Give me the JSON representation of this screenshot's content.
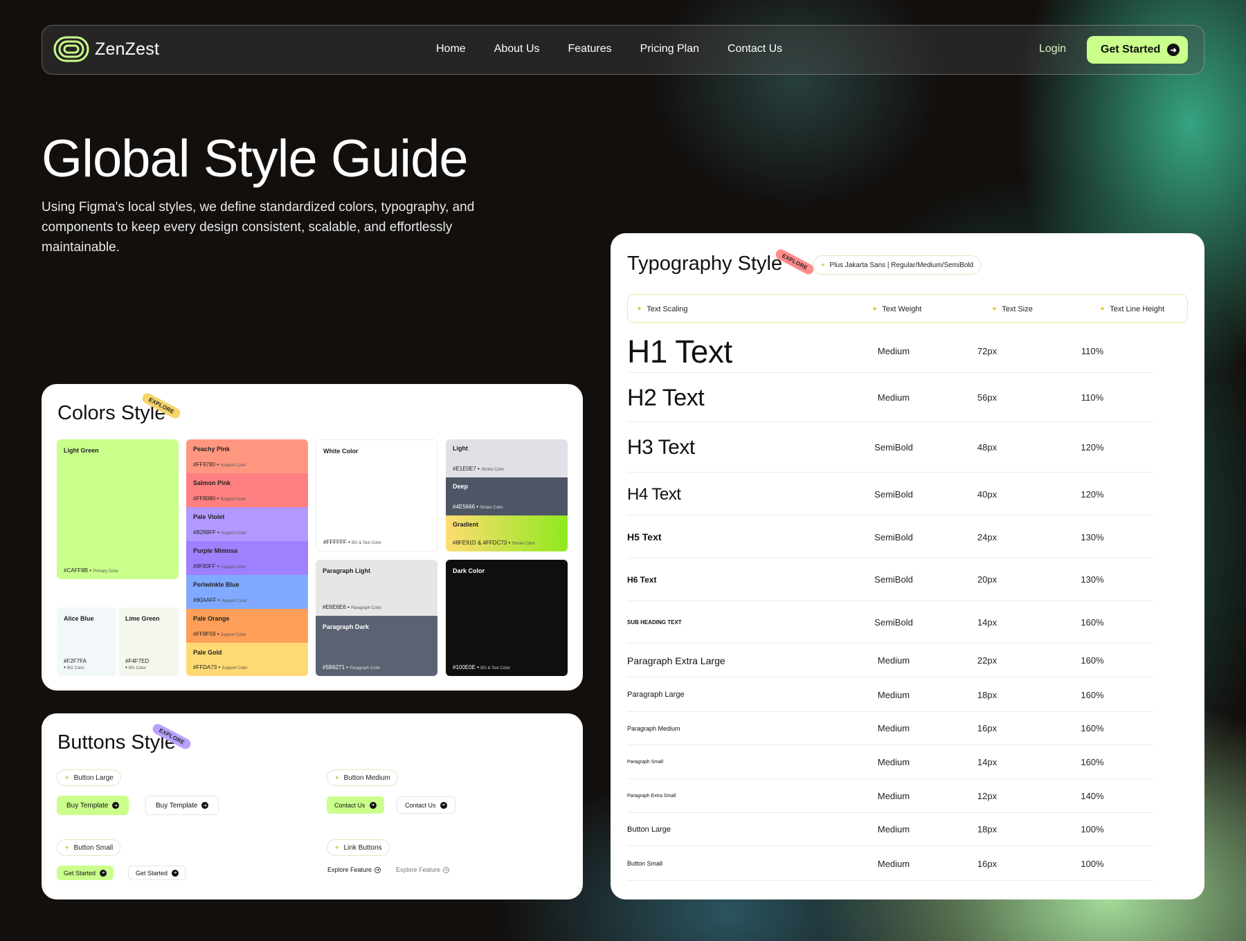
{
  "nav": {
    "brand": "ZenZest",
    "links": [
      "Home",
      "About Us",
      "Features",
      "Pricing Plan",
      "Contact Us"
    ],
    "login": "Login",
    "cta": "Get Started"
  },
  "hero": {
    "title": "Global Style Guide",
    "subtitle": "Using Figma's local styles, we define standardized colors, typography, and components to keep every design consistent, scalable, and effortlessly maintainable."
  },
  "colors": {
    "title": "Colors Style",
    "badge": "EXPLORE",
    "badge_color": "#F5D46A",
    "primary": {
      "name": "Light Green",
      "hex": "#CAFF8B",
      "role": "Primary Color",
      "color": "#CAFF8B"
    },
    "alice": {
      "name": "Alice Blue",
      "hex": "#F2F7FA",
      "role": "BG Color",
      "color": "#F2F7FA"
    },
    "lime": {
      "name": "Lime Green",
      "hex": "#F4F7ED",
      "role": "BG Color",
      "color": "#F4F7ED"
    },
    "support": [
      {
        "name": "Peachy Pink",
        "hex": "#FF9780",
        "role": "Support Color",
        "color": "#FF9780"
      },
      {
        "name": "Salmon Pink",
        "hex": "#FF8080",
        "role": "Support Color",
        "color": "#FF8080"
      },
      {
        "name": "Pale Violet",
        "hex": "#B299FF",
        "role": "Support Color",
        "color": "#B299FF"
      },
      {
        "name": "Purple Mimosa",
        "hex": "#9F80FF",
        "role": "Support Color",
        "color": "#9F80FF"
      },
      {
        "name": "Periwinkle Blue",
        "hex": "#80AAFF",
        "role": "Support Color",
        "color": "#80AAFF"
      },
      {
        "name": "Pale Orange",
        "hex": "#FF9F59",
        "role": "Support Color",
        "color": "#FF9F59"
      },
      {
        "name": "Pale Gold",
        "hex": "#FFDA73",
        "role": "Support Color",
        "color": "#FFDA73"
      }
    ],
    "white": {
      "name": "White Color",
      "hex": "#FFFFFF",
      "role": "BG & Text Color",
      "color": "#FFFFFF"
    },
    "para_light": {
      "name": "Paragraph Light",
      "hex": "#E6E6E6",
      "role": "Paragraph Color",
      "color": "#E6E6E6"
    },
    "para_dark": {
      "name": "Paragraph Dark",
      "hex": "#5B6271",
      "role": "Paragraph Color",
      "color": "#5B6271"
    },
    "light": {
      "name": "Light",
      "hex": "#E1E0E7",
      "role": "Stroke Color",
      "color": "#E1E0E7"
    },
    "deep": {
      "name": "Deep",
      "hex": "#4E5666",
      "role": "Stroke Color",
      "color": "#4E5666"
    },
    "gradient": {
      "name": "Gradient",
      "hex": "#8FE91D & #FFDC73",
      "role": "Stroke Color",
      "color_a": "#FFDC73",
      "color_b": "#8FE91D"
    },
    "dark": {
      "name": "Dark Color",
      "hex": "#100E0E",
      "role": "BG & Text Color",
      "color": "#100E0E"
    }
  },
  "buttons": {
    "title": "Buttons Style",
    "badge": "EXPLORE",
    "badge_color": "#B9A2FF",
    "large_label": "Button Large",
    "large_primary": "Buy Template",
    "large_secondary": "Buy Template",
    "medium_label": "Button Medium",
    "medium_primary": "Contact Us",
    "medium_secondary": "Contact Us",
    "small_label": "Button Small",
    "small_primary": "Get Started",
    "small_secondary": "Get Started",
    "link_label": "Link Buttons",
    "link_primary": "Explore Feature",
    "link_secondary": "Explore Feature"
  },
  "typography": {
    "title": "Typography Style",
    "badge": "EXPLORE",
    "badge_color": "#FF8A8A",
    "font_pill": "Plus Jakarta Sans | Regular/Medium/SemiBold",
    "headers": [
      "Text Scaling",
      "Text Weight",
      "Text Size",
      "Text Line Height"
    ],
    "rows": [
      {
        "label": "H1 Text",
        "weight": "Medium",
        "size": "72px",
        "line": "110%"
      },
      {
        "label": "H2 Text",
        "weight": "Medium",
        "size": "56px",
        "line": "110%"
      },
      {
        "label": "H3 Text",
        "weight": "SemiBold",
        "size": "48px",
        "line": "120%"
      },
      {
        "label": "H4 Text",
        "weight": "SemiBold",
        "size": "40px",
        "line": "120%"
      },
      {
        "label": "H5 Text",
        "weight": "SemiBold",
        "size": "24px",
        "line": "130%"
      },
      {
        "label": "H6 Text",
        "weight": "SemiBold",
        "size": "20px",
        "line": "130%"
      },
      {
        "label": "SUB HEADING TEXT",
        "weight": "SemiBold",
        "size": "14px",
        "line": "160%"
      },
      {
        "label": "Paragraph Extra Large",
        "weight": "Medium",
        "size": "22px",
        "line": "160%"
      },
      {
        "label": "Paragraph Large",
        "weight": "Medium",
        "size": "18px",
        "line": "160%"
      },
      {
        "label": "Paragraph Medium",
        "weight": "Medium",
        "size": "16px",
        "line": "160%"
      },
      {
        "label": "Paragraph Small",
        "weight": "Medium",
        "size": "14px",
        "line": "160%"
      },
      {
        "label": "Paragraph Extra Small",
        "weight": "Medium",
        "size": "12px",
        "line": "140%"
      },
      {
        "label": "Button Large",
        "weight": "Medium",
        "size": "18px",
        "line": "100%"
      },
      {
        "label": "Button Small",
        "weight": "Medium",
        "size": "16px",
        "line": "100%"
      }
    ]
  }
}
